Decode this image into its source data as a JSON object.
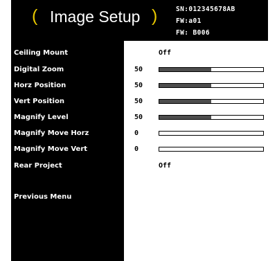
{
  "header": {
    "title": "Image Setup",
    "paren_open": "(",
    "paren_close": ")",
    "serial": "SN:012345678AB",
    "fw1": "FW:a01",
    "fw2": "FW: B006"
  },
  "colors": {
    "paren": "#e8c800",
    "bar_fill": "#4d4d4d"
  },
  "menu": [
    {
      "label": "Ceiling Mount",
      "type": "text",
      "value": "Off"
    },
    {
      "label": "Digital Zoom",
      "type": "slider",
      "value": "50",
      "level": 0.5
    },
    {
      "label": "Horz Position",
      "type": "slider",
      "value": "50",
      "level": 0.5
    },
    {
      "label": "Vert Position",
      "type": "slider",
      "value": "50",
      "level": 0.5
    },
    {
      "label": "Magnify Level",
      "type": "slider",
      "value": "50",
      "level": 0.5
    },
    {
      "label": "Magnify Move Horz",
      "type": "slider",
      "value": "0",
      "level": 0
    },
    {
      "label": "Magnify Move Vert",
      "type": "slider",
      "value": "0",
      "level": 0
    },
    {
      "label": "Rear Project",
      "type": "text",
      "value": "Off"
    }
  ],
  "previous_menu": "Previous Menu"
}
